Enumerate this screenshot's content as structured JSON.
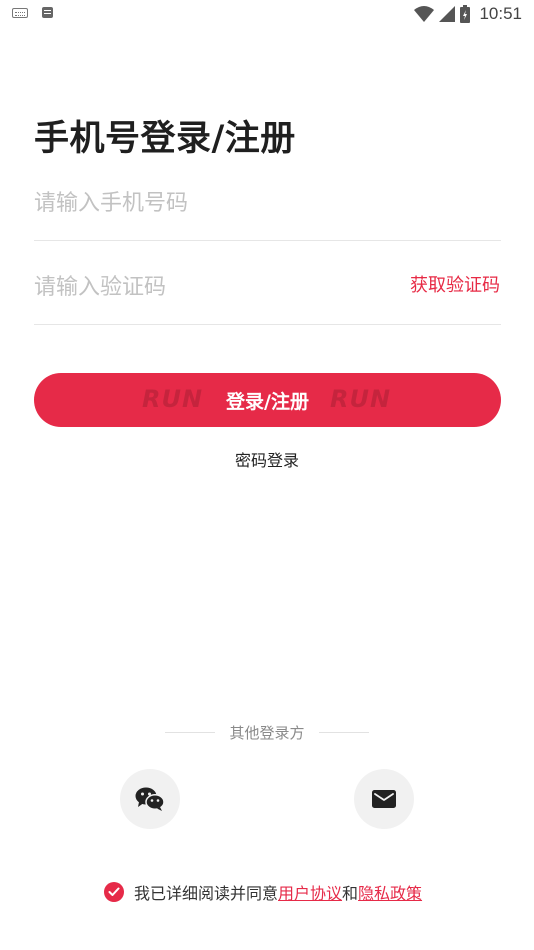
{
  "status_bar": {
    "time": "10:51"
  },
  "page": {
    "title": "手机号登录/注册"
  },
  "phone": {
    "placeholder": "请输入手机号码",
    "value": ""
  },
  "code": {
    "placeholder": "请输入验证码",
    "value": "",
    "get_code_label": "获取验证码"
  },
  "login_button": {
    "label": "登录/注册",
    "watermark": "RUN"
  },
  "password_login_label": "密码登录",
  "other_methods": {
    "label": "其他登录方"
  },
  "agreement": {
    "checked": true,
    "prefix": "我已详细阅读并同意",
    "user_agreement": "用户协议",
    "and": "和",
    "privacy_policy": "隐私政策"
  },
  "colors": {
    "accent": "#e62a48",
    "placeholder": "#c2c2c2",
    "divider": "#e6e6e6",
    "circle_bg": "#f1f1f1"
  },
  "icons": [
    "keyboard-icon",
    "message-icon",
    "wifi-icon",
    "signal-icon",
    "battery-icon",
    "wechat-icon",
    "mail-icon",
    "check-icon"
  ]
}
